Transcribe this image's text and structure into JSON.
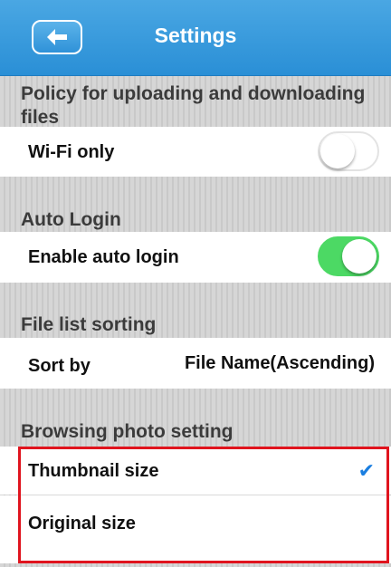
{
  "navbar": {
    "title": "Settings",
    "back_icon": "back-arrow-icon"
  },
  "sections": {
    "upload": {
      "header": "Policy for uploading and downloading files",
      "wifi_only": {
        "label": "Wi-Fi only",
        "enabled": false
      }
    },
    "auto_login": {
      "header": "Auto Login",
      "enable": {
        "label": "Enable auto login",
        "enabled": true
      }
    },
    "sorting": {
      "header": "File list sorting",
      "sort_by": {
        "label": "Sort by",
        "value": "File Name(Ascending)"
      }
    },
    "photo": {
      "header": "Browsing photo setting",
      "options": [
        {
          "label": "Thumbnail size",
          "selected": true
        },
        {
          "label": "Original size",
          "selected": false
        }
      ]
    }
  },
  "colors": {
    "navbar": "#2a8fd6",
    "toggle_on": "#4cd964",
    "checkmark": "#1a7ee0",
    "highlight": "#e0141e"
  }
}
